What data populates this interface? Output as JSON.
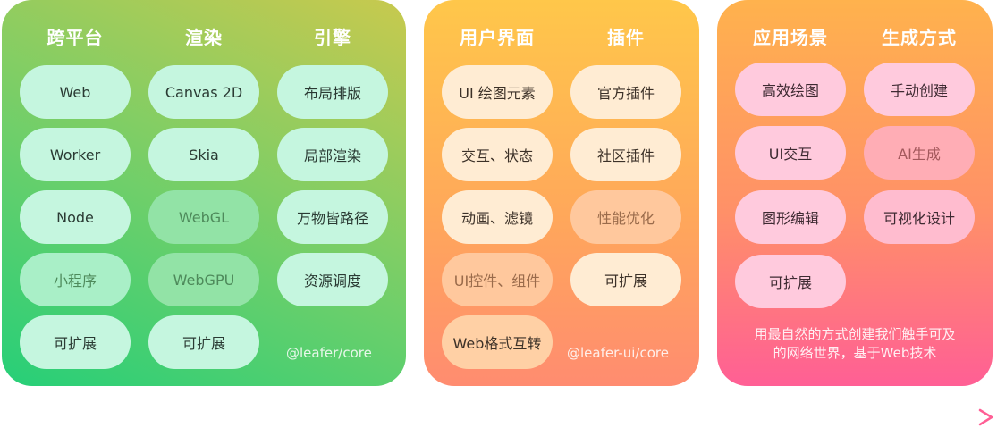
{
  "panel1": {
    "headings": [
      "跨平台",
      "渲染",
      "引擎"
    ],
    "platform": [
      "Web",
      "Worker",
      "Node",
      "小程序",
      "可扩展"
    ],
    "render": [
      "Canvas 2D",
      "Skia",
      "WebGL",
      "WebGPU",
      "可扩展"
    ],
    "engine": [
      "布局排版",
      "局部渲染",
      "万物皆路径",
      "资源调度"
    ],
    "tag": "@leafer/core"
  },
  "panel2": {
    "headings": [
      "用户界面",
      "插件"
    ],
    "ui": [
      "UI 绘图元素",
      "交互、状态",
      "动画、滤镜",
      "UI控件、组件",
      "Web格式互转"
    ],
    "plugins": [
      "官方插件",
      "社区插件",
      "性能优化",
      "可扩展"
    ],
    "tag": "@leafer-ui/core"
  },
  "panel3": {
    "headings": [
      "应用场景",
      "生成方式"
    ],
    "scenes": [
      "高效绘图",
      "UI交互",
      "图形编辑",
      "可扩展"
    ],
    "generation": [
      "手动创建",
      "AI生成",
      "可视化设计"
    ],
    "caption_line1": "用最自然的方式创建我们触手可及",
    "caption_line2": "的网络世界，基于Web技术"
  },
  "colors": {
    "green_pill": "#c5f6df",
    "orange_pill": "#ffecd3",
    "pink_pill": "#ffcadd",
    "arrow_start": "#26cf78",
    "arrow_end": "#ff5f95"
  }
}
